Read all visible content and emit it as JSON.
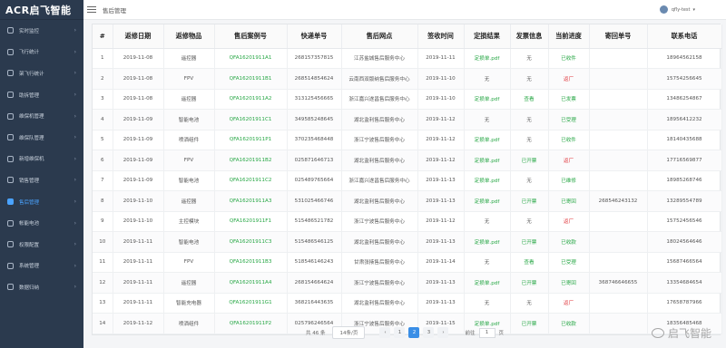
{
  "logo": {
    "text": "ACR启飞智能"
  },
  "sidebar": {
    "items": [
      {
        "label": "实时监控"
      },
      {
        "label": "飞行统计"
      },
      {
        "label": "架飞行统计"
      },
      {
        "label": "助拆管理"
      },
      {
        "label": "维保机管理"
      },
      {
        "label": "维保队管理"
      },
      {
        "label": "新增维保机"
      },
      {
        "label": "销售管理"
      },
      {
        "label": "售后管理"
      },
      {
        "label": "帐能电池"
      },
      {
        "label": "权限配置"
      },
      {
        "label": "系统管理"
      },
      {
        "label": "数据归纳"
      }
    ],
    "active_index": 8
  },
  "topbar": {
    "breadcrumb": "售后管理",
    "user": "qfly-test"
  },
  "table": {
    "headers": [
      "#",
      "返修日期",
      "返修物品",
      "售后案例号",
      "快递单号",
      "售后网点",
      "签收时间",
      "定损结果",
      "发票信息",
      "当前进度",
      "寄回单号",
      "联系电话"
    ],
    "rows": [
      [
        "1",
        "2019-11-08",
        "遥控器",
        "QFA16201911A1",
        "268157357815",
        "江苏盐城售后服务中心",
        "2019-11-11",
        "定损单.pdf",
        "无",
        "已收件",
        "",
        "18964562158"
      ],
      [
        "2",
        "2019-11-08",
        "FPV",
        "QFA16201911B1",
        "268514854624",
        "云南西双版纳售后服务中心",
        "2019-11-10",
        "无",
        "无",
        "返厂",
        "",
        "15754256645"
      ],
      [
        "3",
        "2019-11-08",
        "遥控器",
        "QFA16201911A2",
        "313125456665",
        "浙江嘉兴遂昌售后服务中心",
        "2019-11-10",
        "定损单.pdf",
        "查看",
        "已发票",
        "",
        "13486254867"
      ],
      [
        "4",
        "2019-11-09",
        "智能电池",
        "QFA16201911C1",
        "349585248645",
        "湖北监利售后服务中心",
        "2019-11-12",
        "无",
        "无",
        "已受理",
        "",
        "18956412232"
      ],
      [
        "5",
        "2019-11-09",
        "喷洒组件",
        "QFA16201911P1",
        "370235468448",
        "浙江宁波售后服务中心",
        "2019-11-12",
        "定损单.pdf",
        "无",
        "已收件",
        "",
        "18140435688"
      ],
      [
        "6",
        "2019-11-09",
        "FPV",
        "QFA16201911B2",
        "025871646713",
        "湖北监利售后服务中心",
        "2019-11-12",
        "定损单.pdf",
        "已开票",
        "返厂",
        "",
        "17716569877"
      ],
      [
        "7",
        "2019-11-09",
        "智能电池",
        "QFA16201911C2",
        "025489765664",
        "浙江嘉兴遂昌售后服务中心",
        "2019-11-13",
        "定损单.pdf",
        "无",
        "已维修",
        "",
        "18985268746"
      ],
      [
        "8",
        "2019-11-10",
        "遥控器",
        "QFA16201911A3",
        "531025466746",
        "湖北监利售后服务中心",
        "2019-11-13",
        "定损单.pdf",
        "已开票",
        "已寄回",
        "268546243132",
        "13289554789"
      ],
      [
        "9",
        "2019-11-10",
        "主控模块",
        "QFA16201911F1",
        "515486521782",
        "浙江宁波售后服务中心",
        "2019-11-12",
        "无",
        "无",
        "返厂",
        "",
        "15752456546"
      ],
      [
        "10",
        "2019-11-11",
        "智能电池",
        "QFA16201911C3",
        "515486546125",
        "湖北监利售后服务中心",
        "2019-11-13",
        "定损单.pdf",
        "已开票",
        "已收款",
        "",
        "18024564646"
      ],
      [
        "11",
        "2019-11-11",
        "FPV",
        "QFA16201911B3",
        "518546146243",
        "甘肃张掖售后服务中心",
        "2019-11-14",
        "无",
        "查看",
        "已受理",
        "",
        "15687466564"
      ],
      [
        "12",
        "2019-11-11",
        "遥控器",
        "QFA16201911A4",
        "268154664624",
        "浙江宁波售后服务中心",
        "2019-11-13",
        "定损单.pdf",
        "已开票",
        "已寄回",
        "368746646655",
        "13354684654"
      ],
      [
        "13",
        "2019-11-11",
        "智能充电器",
        "QFA16201911G1",
        "368216443635",
        "湖北监利售后服务中心",
        "2019-11-13",
        "无",
        "无",
        "返厂",
        "",
        "17658787966"
      ],
      [
        "14",
        "2019-11-12",
        "喷洒组件",
        "QFA16201911P2",
        "025796246564",
        "浙江宁波售后服务中心",
        "2019-11-15",
        "定损单.pdf",
        "已开票",
        "已收款",
        "",
        "18356485468"
      ]
    ]
  },
  "pagination": {
    "total": "共 46 条",
    "page_size": "14条/页",
    "pages": [
      "1",
      "2",
      "3"
    ],
    "current": "2",
    "goto_label": "前往",
    "goto_value": "1",
    "goto_suffix": "页"
  },
  "watermark": {
    "text": "启飞智能"
  },
  "colors": {
    "sidebar": "#2b3a4e",
    "link_green": "#27a745",
    "status_red": "#e0393e",
    "accent": "#3a8ee6"
  }
}
